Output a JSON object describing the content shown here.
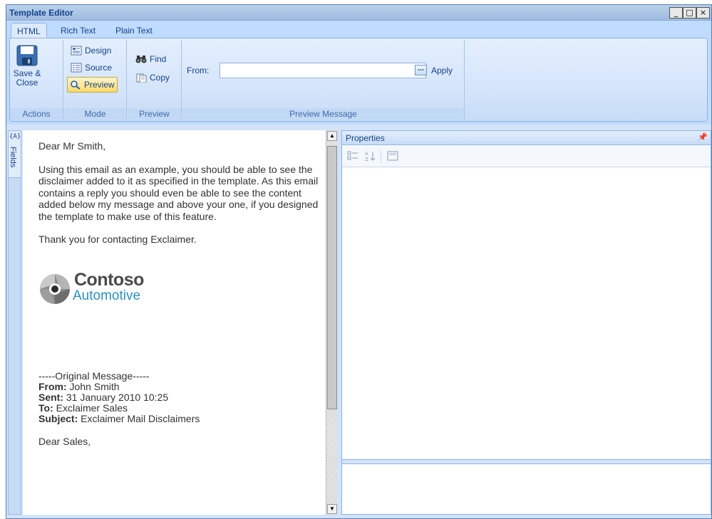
{
  "window": {
    "title": "Template Editor",
    "buttons": [
      "_",
      "□",
      "×"
    ]
  },
  "tabs": [
    {
      "label": "HTML",
      "active": true
    },
    {
      "label": "Rich Text",
      "active": false
    },
    {
      "label": "Plain Text",
      "active": false
    }
  ],
  "ribbon": {
    "actions": {
      "label": "Actions",
      "save_close": "Save &\nClose",
      "icon": "floppy-disk-icon"
    },
    "mode": {
      "label": "Mode",
      "design": "Design",
      "source": "Source",
      "preview": "Preview",
      "selected": "Preview"
    },
    "preview": {
      "label": "Preview",
      "find": "Find",
      "copy": "Copy"
    },
    "preview_message": {
      "label": "Preview Message",
      "from_label": "From:",
      "from_value": "",
      "browse": "...",
      "apply": "Apply"
    }
  },
  "side": {
    "fields_label": "Fields",
    "glyph": "{A}"
  },
  "editor": {
    "greeting": "Dear Mr Smith,",
    "body": "Using this email as an example, you should be able to see the disclaimer added to it as specified in the template. As this email contains a reply you should even be able to see the content added below my message and above your one, if you designed the template to make use of this feature.",
    "thanks": "Thank you for contacting Exclaimer.",
    "logo": {
      "line1": "Contoso",
      "line2": "Automotive"
    },
    "original": {
      "header": "-----Original Message-----",
      "from_label": "From:",
      "from_value": " John Smith",
      "sent_label": "Sent:",
      "sent_value": " 31 January 2010 10:25",
      "to_label": "To:",
      "to_value": " Exclaimer Sales",
      "subject_label": "Subject:",
      "subject_value": " Exclaimer Mail Disclaimers"
    },
    "closing": "Dear Sales,"
  },
  "properties": {
    "title": "Properties",
    "pin": "ᵖ"
  },
  "colors": {
    "ribbon_bg": "#d5e5fa",
    "accent": "#15428b",
    "selected_btn": "#ffd967",
    "logo_blue": "#2f8fbf"
  }
}
